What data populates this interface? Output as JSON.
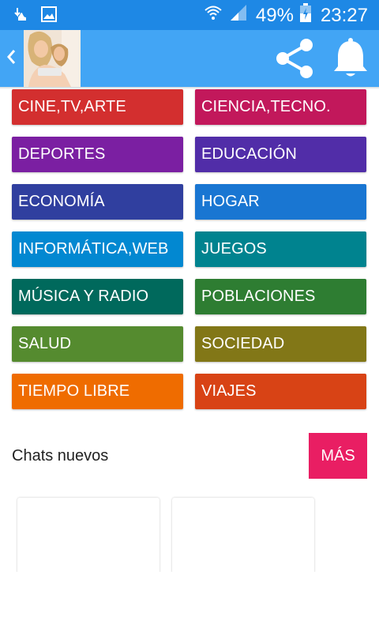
{
  "status_bar": {
    "battery_percent": "49%",
    "time": "23:27",
    "icons": [
      "download-icon",
      "image-icon",
      "wifi-icon",
      "signal-icon",
      "battery-charging-icon"
    ]
  },
  "app_bar": {
    "back_icon": "chevron-left-icon",
    "share_icon": "share-icon",
    "bell_icon": "bell-icon"
  },
  "categories": [
    {
      "label": "CINE,TV,ARTE",
      "color": "#d32f2f"
    },
    {
      "label": "CIENCIA,TECNO.",
      "color": "#c2185b"
    },
    {
      "label": "DEPORTES",
      "color": "#7b1fa2"
    },
    {
      "label": "EDUCACIÓN",
      "color": "#512da8"
    },
    {
      "label": "ECONOMÍA",
      "color": "#303f9f"
    },
    {
      "label": "HOGAR",
      "color": "#1976d2"
    },
    {
      "label": "INFORMÁTICA,WEB",
      "color": "#0288d1"
    },
    {
      "label": "JUEGOS",
      "color": "#00838f"
    },
    {
      "label": "MÚSICA Y RADIO",
      "color": "#00695c"
    },
    {
      "label": "POBLACIONES",
      "color": "#2e7d32"
    },
    {
      "label": "SALUD",
      "color": "#558b2f"
    },
    {
      "label": "SOCIEDAD",
      "color": "#827717"
    },
    {
      "label": "TIEMPO LIBRE",
      "color": "#ef6c00"
    },
    {
      "label": "VIAJES",
      "color": "#d84315"
    }
  ],
  "chats": {
    "title": "Chats nuevos",
    "more_label": "MÁS",
    "more_color": "#e91e63"
  }
}
